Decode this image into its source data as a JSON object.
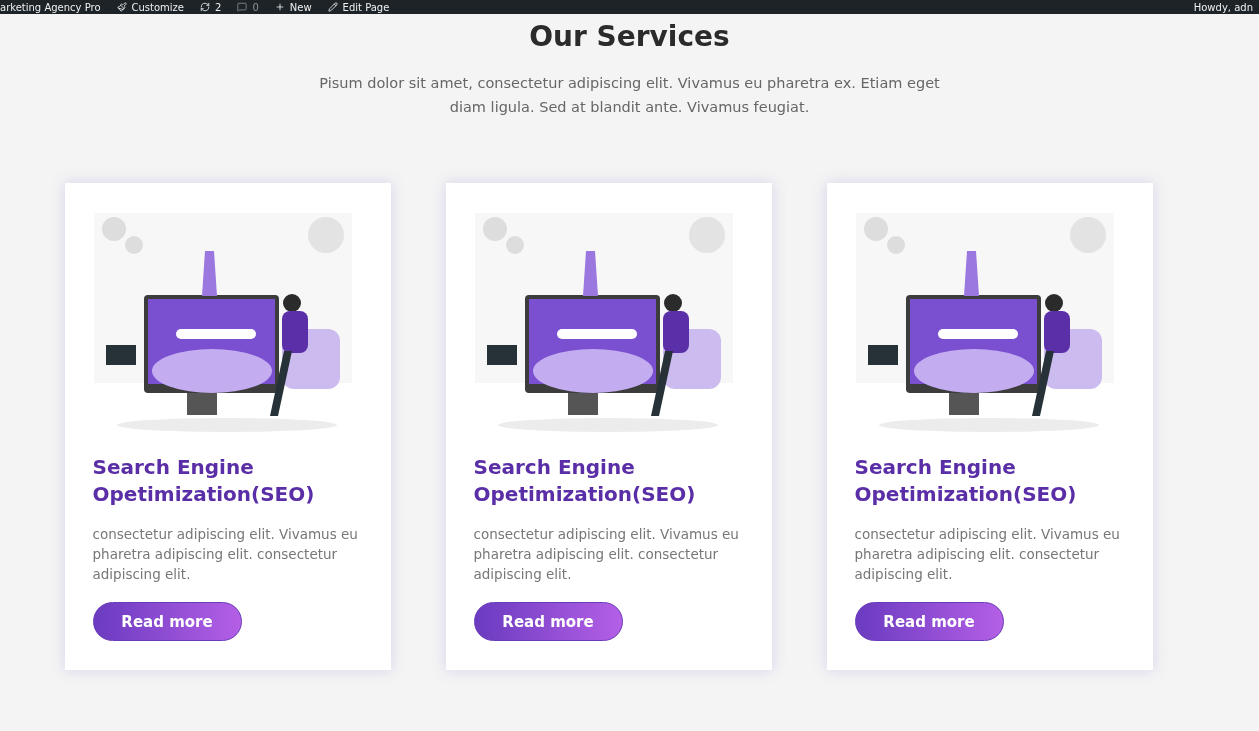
{
  "admin_bar": {
    "items": [
      {
        "kind": "site",
        "label": "arketing Agency Pro"
      },
      {
        "kind": "customize",
        "label": "Customize"
      },
      {
        "kind": "updates",
        "label": "2"
      },
      {
        "kind": "comments",
        "label": "0"
      },
      {
        "kind": "new",
        "label": "New"
      },
      {
        "kind": "edit",
        "label": "Edit Page"
      }
    ],
    "greeting": "Howdy, adn"
  },
  "section": {
    "title": "Our Services",
    "intro": "Pisum dolor sit amet, consectetur adipiscing elit. Vivamus eu pharetra ex. Etiam eget diam ligula. Sed at blandit ante. Vivamus feugiat."
  },
  "cards": [
    {
      "title": "Search Engine Opetimization(SEO)",
      "text": "consectetur adipiscing elit. Vivamus eu pharetra adipiscing elit. consectetur adipiscing elit.",
      "button": "Read more"
    },
    {
      "title": "Search Engine Opetimization(SEO)",
      "text": "consectetur adipiscing elit. Vivamus eu pharetra adipiscing elit. consectetur adipiscing elit.",
      "button": "Read more"
    },
    {
      "title": "Search Engine Opetimization(SEO)",
      "text": "consectetur adipiscing elit. Vivamus eu pharetra adipiscing elit. consectetur adipiscing elit.",
      "button": "Read more"
    }
  ]
}
